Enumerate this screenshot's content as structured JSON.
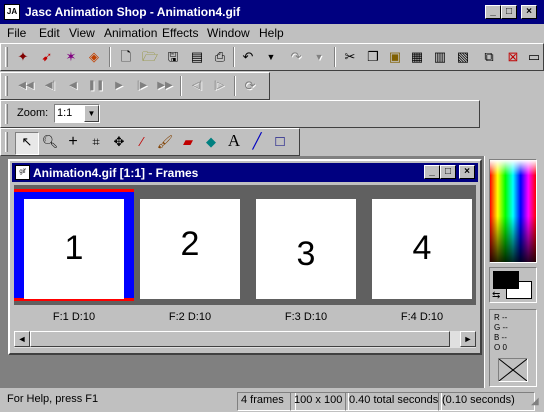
{
  "window": {
    "title": "Jasc Animation Shop - Animation4.gif",
    "app_icon_text": "JA",
    "minimize_glyph": "_",
    "maximize_glyph": "□",
    "close_glyph": "×"
  },
  "menu": [
    "File",
    "Edit",
    "View",
    "Animation",
    "Effects",
    "Window",
    "Help"
  ],
  "zoom": {
    "label": "Zoom:",
    "value": "1:1",
    "arrow": "▼"
  },
  "child_window": {
    "title": "Animation4.gif [1:1] - Frames",
    "icon_text": "gif"
  },
  "frames": [
    {
      "number": "1",
      "label": "F:1   D:10",
      "selected": true
    },
    {
      "number": "2",
      "label": "F:2   D:10",
      "selected": false
    },
    {
      "number": "3",
      "label": "F:3   D:10",
      "selected": false
    },
    {
      "number": "4",
      "label": "F:4   D:10",
      "selected": false
    }
  ],
  "scroll": {
    "left": "◄",
    "right": "►"
  },
  "color_info": {
    "r": "R --",
    "g": "G --",
    "b": "B --",
    "o": "O 0"
  },
  "status": {
    "help": "For Help, press F1",
    "frames": "4 frames",
    "size": "100 x 100",
    "total": "0.40 total seconds",
    "seconds": "(0.10 seconds)"
  },
  "colors": {
    "title_bar": "#000080",
    "selection_border": "#0000ff",
    "selection_accent": "#ff0000",
    "frames_background": "#606060"
  },
  "toolbar_icons": {
    "main": [
      "wizard-icon",
      "animation-wizard-icon",
      "banner-wizard-icon",
      "optimize-icon",
      "new-icon",
      "open-icon",
      "save-icon",
      "save-as-icon",
      "print-icon",
      "undo-icon",
      "redo-icon",
      "cut-icon",
      "copy-icon",
      "paste-icon",
      "paste-as-new-icon",
      "paste-after-icon",
      "paste-before-icon",
      "insert-frames-icon",
      "delete-icon",
      "properties-icon"
    ],
    "playback": [
      "first-frame-icon",
      "previous-frame-icon",
      "play-reverse-icon",
      "pause-icon",
      "play-icon",
      "next-frame-icon",
      "last-frame-icon",
      "step-back-icon",
      "step-forward-icon",
      "view-animation-icon"
    ],
    "tools": [
      "arrow-tool-icon",
      "zoom-tool-icon",
      "crosshair-tool-icon",
      "crop-tool-icon",
      "mover-tool-icon",
      "dropper-tool-icon",
      "paintbrush-tool-icon",
      "eraser-tool-icon",
      "fill-tool-icon",
      "text-tool-icon",
      "line-tool-icon",
      "rectangle-tool-icon"
    ]
  }
}
